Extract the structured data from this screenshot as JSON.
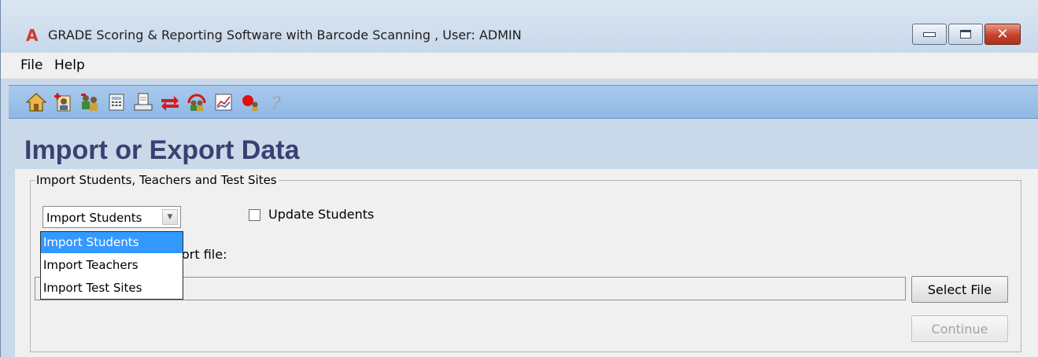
{
  "window": {
    "title": "GRADE Scoring & Reporting Software with Barcode Scanning , User: ADMIN",
    "app_icon": "A"
  },
  "menu": {
    "items": [
      "File",
      "Help"
    ]
  },
  "toolbar": {
    "icons": [
      "home-icon",
      "add-student-icon",
      "students-group-icon",
      "calculator-icon",
      "print-icon",
      "import-export-icon",
      "teachers-icon",
      "reports-chart-icon",
      "record-icon",
      "help-icon"
    ]
  },
  "page": {
    "heading": "Import or Export Data"
  },
  "import_group": {
    "legend": "Import Students, Teachers and Test Sites",
    "select_value": "Import Students",
    "options": [
      "Import Students",
      "Import Teachers",
      "Import Test Sites"
    ],
    "selected_index": 0,
    "update_checkbox_label": "Update Students",
    "update_checked": false,
    "file_label_partial": "ort file:",
    "file_path": "",
    "select_file_label": "Select File",
    "continue_label": "Continue"
  },
  "colors": {
    "accent": "#3399ff",
    "heading": "#3c3f73",
    "toolbar": "#99bfe8"
  }
}
